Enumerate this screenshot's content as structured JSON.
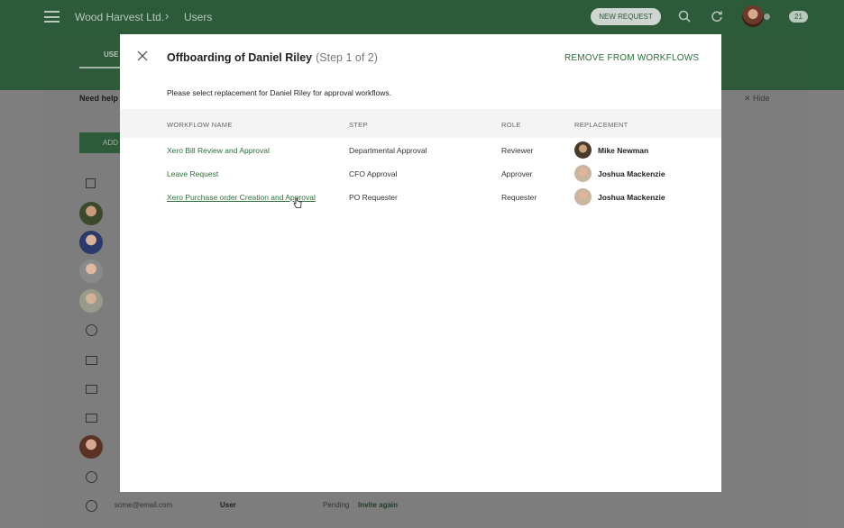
{
  "app": {
    "org_name": "Wood Harvest Ltd.",
    "breadcrumb_current": "Users",
    "new_request_label": "NEW REQUEST",
    "notification_count": "21",
    "icons": [
      "menu-icon",
      "chevron-right-icon",
      "search-icon",
      "refresh-icon",
      "avatar",
      "badge"
    ]
  },
  "background_page": {
    "tab_label": "USE",
    "help_text": "Need help",
    "hide_label": "Hide",
    "add_button_label": "ADD",
    "last_row": {
      "email": "some@email.com",
      "role": "User",
      "status": "Pending",
      "action": "Invite again"
    }
  },
  "modal": {
    "title": "Offboarding of Daniel Riley",
    "step_text": "(Step 1 of 2)",
    "remove_label": "REMOVE FROM WORKFLOWS",
    "instruction": "Please select replacement for Daniel Riley for approval workflows.",
    "columns": {
      "workflow": "WORKFLOW NAME",
      "step": "STEP",
      "role": "ROLE",
      "replacement": "REPLACEMENT"
    },
    "rows": [
      {
        "workflow": "Xero Bill Review and Approval",
        "step": "Departmental Approval",
        "role": "Reviewer",
        "replacement": "Mike Newman"
      },
      {
        "workflow": "Leave Request",
        "step": "CFO Approval",
        "role": "Approver",
        "replacement": "Joshua Mackenzie"
      },
      {
        "workflow": "Xero Purchase order Creation and Approval",
        "step": "PO Requester",
        "role": "Requester",
        "replacement": "Joshua Mackenzie"
      }
    ]
  },
  "colors": {
    "brand_green": "#2d5a39",
    "link_green": "#2d6e3a",
    "overlay_gray": "#7f7f7f"
  }
}
